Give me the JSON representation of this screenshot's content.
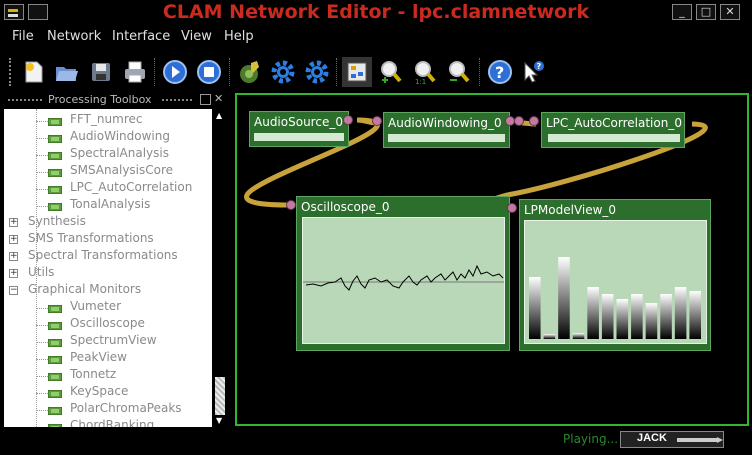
{
  "window": {
    "title": "CLAM Network Editor - lpc.clamnetwork",
    "min_label": "_",
    "max_label": "□",
    "close_label": "✕"
  },
  "menu": {
    "items": [
      {
        "label": "File"
      },
      {
        "label": "Network"
      },
      {
        "label": "Interface"
      },
      {
        "label": "View"
      },
      {
        "label": "Help"
      }
    ]
  },
  "toolbar": {
    "icons": [
      "new-network-icon",
      "open-icon",
      "save-icon",
      "print-icon",
      "play-icon",
      "stop-icon",
      "compile-icon",
      "settings-icon",
      "backend-icon",
      "processing-icon",
      "zoom-in-icon",
      "zoom-reset-icon",
      "zoom-out-icon",
      "help-icon",
      "whats-this-icon"
    ]
  },
  "toolbox": {
    "title": "Processing Toolbox",
    "leaves_top": [
      "FFT_numrec",
      "AudioWindowing",
      "SpectralAnalysis",
      "SMSAnalysisCore",
      "LPC_AutoCorrelation",
      "TonalAnalysis"
    ],
    "categories_collapsed": [
      "Synthesis",
      "SMS Transformations",
      "Spectral Transformations",
      "Utils"
    ],
    "category_open": "Graphical Monitors",
    "leaves_monitors": [
      "Vumeter",
      "Oscilloscope",
      "SpectrumView",
      "PeakView",
      "Tonnetz",
      "KeySpace",
      "PolarChromaPeaks",
      "ChordRanking"
    ]
  },
  "network": {
    "processings": [
      {
        "name": "AudioSource_0"
      },
      {
        "name": "AudioWindowing_0"
      },
      {
        "name": "LPC_AutoCorrelation_0"
      },
      {
        "name": "Oscilloscope_0"
      },
      {
        "name": "LPModelView_0"
      }
    ],
    "lpmodel_levels": [
      0.62,
      0.05,
      0.82,
      0.06,
      0.52,
      0.45,
      0.4,
      0.45,
      0.36,
      0.45,
      0.52,
      0.48
    ],
    "colors": {
      "border": "#2fb82f",
      "box": "#2c6e2c",
      "wire": "#c8a23a",
      "title": "#cc2a1e"
    }
  },
  "status": {
    "playing": "Playing...",
    "jack": "JACK"
  }
}
